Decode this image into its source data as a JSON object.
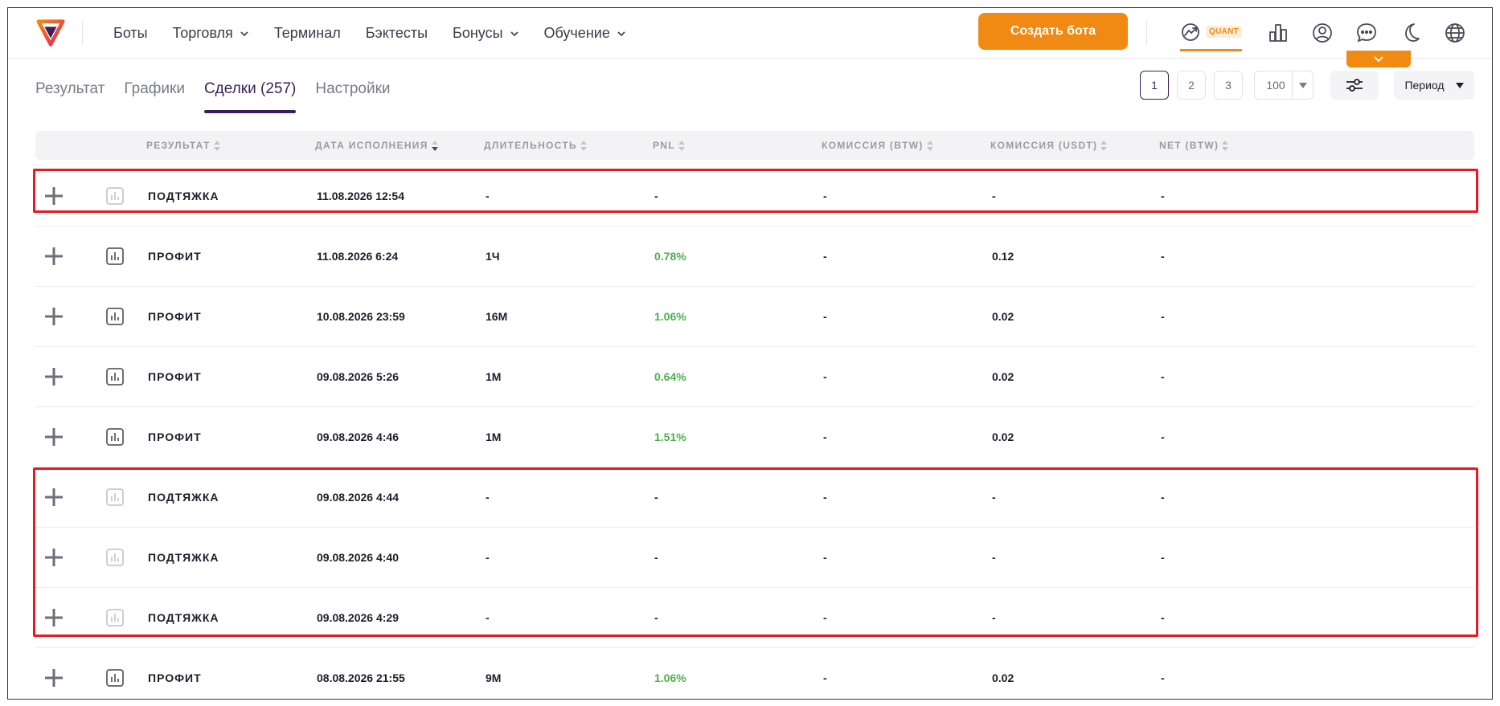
{
  "header": {
    "nav": [
      {
        "label": "Боты",
        "dropdown": false
      },
      {
        "label": "Торговля",
        "dropdown": true
      },
      {
        "label": "Терминал",
        "dropdown": false
      },
      {
        "label": "Бэктесты",
        "dropdown": false
      },
      {
        "label": "Бонусы",
        "dropdown": true
      },
      {
        "label": "Обучение",
        "dropdown": true
      }
    ],
    "create_button": "Создать бота",
    "quant_badge": "QUANT",
    "icons": [
      "quant-chart-icon",
      "bar-chart-icon",
      "user-icon",
      "chat-icon",
      "moon-icon",
      "globe-icon"
    ],
    "accent_color": "#f08a12"
  },
  "tabs": [
    {
      "label": "Результат",
      "active": false
    },
    {
      "label": "Графики",
      "active": false
    },
    {
      "label": "Сделки (257)",
      "active": true
    },
    {
      "label": "Настройки",
      "active": false
    }
  ],
  "pagination": {
    "pages": [
      "1",
      "2",
      "3"
    ],
    "current": "1",
    "per_page": "100"
  },
  "period_label": "Период",
  "table": {
    "columns": [
      "РЕЗУЛЬТАТ",
      "ДАТА ИСПОЛНЕНИЯ",
      "ДЛИТЕЛЬНОСТЬ",
      "PNL",
      "КОМИССИЯ (BTW)",
      "КОМИССИЯ (USDT)",
      "NET (BTW)"
    ],
    "rows": [
      {
        "result": "ПОДТЯЖКА",
        "date": "11.08.2026 12:54",
        "duration": "-",
        "pnl": "-",
        "fee_btw": "-",
        "fee_usdt": "-",
        "net": "-",
        "chart_enabled": false
      },
      {
        "result": "ПРОФИТ",
        "date": "11.08.2026 6:24",
        "duration": "1Ч",
        "pnl": "0.78%",
        "fee_btw": "-",
        "fee_usdt": "0.12",
        "net": "-",
        "chart_enabled": true
      },
      {
        "result": "ПРОФИТ",
        "date": "10.08.2026 23:59",
        "duration": "16М",
        "pnl": "1.06%",
        "fee_btw": "-",
        "fee_usdt": "0.02",
        "net": "-",
        "chart_enabled": true
      },
      {
        "result": "ПРОФИТ",
        "date": "09.08.2026 5:26",
        "duration": "1М",
        "pnl": "0.64%",
        "fee_btw": "-",
        "fee_usdt": "0.02",
        "net": "-",
        "chart_enabled": true
      },
      {
        "result": "ПРОФИТ",
        "date": "09.08.2026 4:46",
        "duration": "1М",
        "pnl": "1.51%",
        "fee_btw": "-",
        "fee_usdt": "0.02",
        "net": "-",
        "chart_enabled": true
      },
      {
        "result": "ПОДТЯЖКА",
        "date": "09.08.2026 4:44",
        "duration": "-",
        "pnl": "-",
        "fee_btw": "-",
        "fee_usdt": "-",
        "net": "-",
        "chart_enabled": false
      },
      {
        "result": "ПОДТЯЖКА",
        "date": "09.08.2026 4:40",
        "duration": "-",
        "pnl": "-",
        "fee_btw": "-",
        "fee_usdt": "-",
        "net": "-",
        "chart_enabled": false
      },
      {
        "result": "ПОДТЯЖКА",
        "date": "09.08.2026 4:29",
        "duration": "-",
        "pnl": "-",
        "fee_btw": "-",
        "fee_usdt": "-",
        "net": "-",
        "chart_enabled": false
      },
      {
        "result": "ПРОФИТ",
        "date": "08.08.2026 21:55",
        "duration": "9М",
        "pnl": "1.06%",
        "fee_btw": "-",
        "fee_usdt": "0.02",
        "net": "-",
        "chart_enabled": true
      }
    ],
    "pnl_positive_color": "#4caf50"
  }
}
